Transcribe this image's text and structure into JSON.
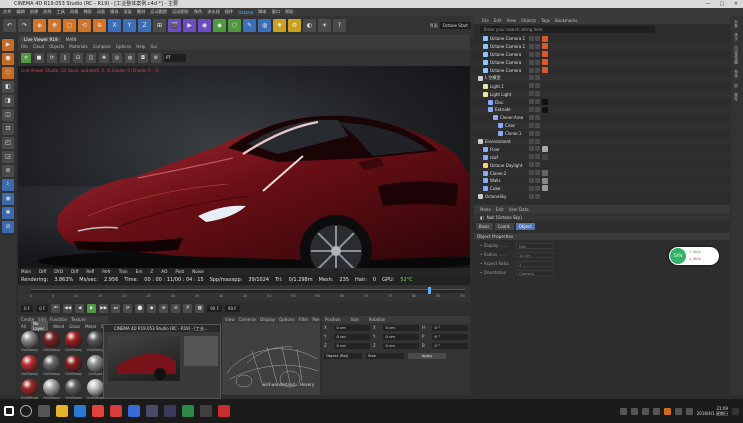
{
  "window": {
    "title": "CINEMA 4D R19.053 Studio (RC - R19) - [工业整体案例.c4d *] - 主要",
    "minimize": "—",
    "maximize": "□",
    "close": "✕"
  },
  "menubar": [
    "文件",
    "编辑",
    "创建",
    "选择",
    "工具",
    "网格",
    "捕捉",
    "动画",
    "模拟",
    "渲染",
    "雕刻",
    "运动跟踪",
    "运动图形",
    "角色",
    "流水线",
    "插件",
    "Octane",
    "脚本",
    "窗口",
    "帮助"
  ],
  "menubar_highlight": "Octane",
  "toolbar": {
    "buttons": [
      "↶",
      "↷",
      "◈",
      "✥",
      "▢",
      "⟲",
      "⊕",
      "X",
      "Y",
      "Z",
      "⊞",
      "🎬",
      "▶",
      "◉",
      "◆",
      "⬡",
      "✎",
      "◍",
      "✸",
      "♻",
      "◐",
      "☀",
      "?"
    ],
    "layout_label": "界面",
    "layout_value": "Octane Start"
  },
  "leftbar": [
    "▶",
    "⬢",
    "⬡",
    "◧",
    "◨",
    "◫",
    "⊡",
    "◰",
    "◲",
    "⊚",
    "⌇",
    "◉",
    "✱",
    "⊘"
  ],
  "viewport": {
    "tabs": [
      "Live Viewer R19",
      "MAIN"
    ],
    "active_tab": "Live Viewer R19",
    "menu": [
      "File",
      "Cloud",
      "Objects",
      "Materials",
      "Compare",
      "Options",
      "Help",
      "Gui"
    ],
    "mode_value": "PT",
    "note": "Live Viewer Studio: [3] Voxel, update(0, 0, 4) Shader 0 (Shader 0 - 1)",
    "status_tabs": [
      "Main",
      "Diff",
      "DYD",
      "Diff",
      "Refl",
      "Refr",
      "Tran",
      "Em",
      "Z",
      "AO",
      "Post",
      "Noise"
    ],
    "render_label": "Rendering:",
    "render_pct": "3.863%",
    "ms_label": "Ms/sec:",
    "ms_val": "2.956",
    "time_label": "Time:",
    "time_val": "00 : 00 : 11/00 : 04 : 15",
    "spp_label": "Spp/maxspp:",
    "spp_val": "39/1024",
    "tri_label": "Tri:",
    "tri_val": "0/1.298m",
    "mesh_label": "Mesh:",
    "mesh_val": "235",
    "hair_label": "Hair:",
    "hair_val": "0",
    "gpu_label": "GPU:",
    "gpu_val": "52°C"
  },
  "timeline": {
    "ticks": [
      "0",
      "5",
      "10",
      "15",
      "20",
      "25",
      "30",
      "35",
      "40",
      "45",
      "50",
      "55",
      "60",
      "65",
      "70",
      "75",
      "80",
      "85",
      "90"
    ],
    "frame_start": "0 F",
    "frame_cur": "0 F",
    "frame_end": "90 F",
    "frame_max": "90 F",
    "buttons": [
      "⏮",
      "◀◀",
      "◀",
      "▶",
      "▶▶",
      "⏭",
      "⟳",
      "⬤",
      "◆",
      "⊕",
      "⊘",
      "P",
      "▦"
    ]
  },
  "materials": {
    "menu": [
      "Create",
      "Edit",
      "Function",
      "Texture"
    ],
    "tabs": [
      "All",
      "No Layer",
      "Wood",
      "Glass",
      "Metal",
      "Car"
    ],
    "active_tab": "No Layer",
    "items": [
      {
        "name": "OctGlossy",
        "color": "#8a8a8a"
      },
      {
        "name": "OctGlossy",
        "color": "#7a2222"
      },
      {
        "name": "OctGlossy",
        "color": "#a32020"
      },
      {
        "name": "OctGlossy",
        "color": "#5a5a5a"
      },
      {
        "name": "OctGlossy",
        "color": "#b83030"
      },
      {
        "name": "OctGlossy",
        "color": "#6a6a6a"
      },
      {
        "name": "OctGlossy",
        "color": "#8a1f1f"
      },
      {
        "name": "OctSpec",
        "color": "#909090"
      },
      {
        "name": "OctDiffuse",
        "color": "#9c2828"
      },
      {
        "name": "OctGlossy",
        "color": "#aaaaaa"
      },
      {
        "name": "OctGlossy",
        "color": "#5f5f5f"
      },
      {
        "name": "OctDiffuse",
        "color": "#c4c4c4"
      }
    ]
  },
  "popup": {
    "title": "CINEMA 4D R19.053 Studio (RC - R19) - [工业..."
  },
  "wireframe": {
    "menu": [
      "View",
      "Cameras",
      "Display",
      "Options",
      "Filter",
      "Panel"
    ],
    "caption": "wild wonderland...  Hovery"
  },
  "coords": {
    "menu": [
      "Position",
      "Size",
      "Rotation"
    ],
    "rows": [
      {
        "axis": "X",
        "pos": "0 cm",
        "size": "0 cm",
        "rot_label": "H",
        "rot": "0 °"
      },
      {
        "axis": "Y",
        "pos": "0 cm",
        "size": "0 cm",
        "rot_label": "P",
        "rot": "0 °"
      },
      {
        "axis": "Z",
        "pos": "0 cm",
        "size": "0 cm",
        "rot_label": "B",
        "rot": "0 °"
      }
    ],
    "mode": "Object (Rel)",
    "size_mode": "Size",
    "apply": "Apply"
  },
  "objects": {
    "menu": [
      "File",
      "Edit",
      "View",
      "Objects",
      "Tags",
      "Bookmarks"
    ],
    "search_placeholder": "Enter your search string here",
    "rows": [
      {
        "name": "Octane Camera.1",
        "indent": 1,
        "color": "#8cc8ff",
        "tag": "#e0582a"
      },
      {
        "name": "Octane Camera.1",
        "indent": 1,
        "color": "#8cc8ff",
        "tag": "#e0582a"
      },
      {
        "name": "Octane Camera",
        "indent": 1,
        "color": "#8cc8ff",
        "tag": "#e0582a"
      },
      {
        "name": "Octane Camera",
        "indent": 1,
        "color": "#8cc8ff",
        "tag": "#e0582a"
      },
      {
        "name": "Octane Camera",
        "indent": 1,
        "color": "#8cc8ff",
        "tag": "#e0582a"
      },
      {
        "name": "L 空模型",
        "indent": 0,
        "color": "#cccccc",
        "tag": ""
      },
      {
        "name": "Light.1",
        "indent": 1,
        "color": "#e8e8a0",
        "tag": ""
      },
      {
        "name": "Light Light",
        "indent": 1,
        "color": "#e8e8a0",
        "tag": ""
      },
      {
        "name": "Disc",
        "indent": 2,
        "color": "#88aaff",
        "tag": "#111"
      },
      {
        "name": "Extrude",
        "indent": 2,
        "color": "#88aaff",
        "tag": "#111"
      },
      {
        "name": "Cloner.Area",
        "indent": 3,
        "color": "#88aaff",
        "tag": ""
      },
      {
        "name": "Ciroc",
        "indent": 4,
        "color": "#88aaff",
        "tag": ""
      },
      {
        "name": "Cloner.1",
        "indent": 4,
        "color": "#88aaff",
        "tag": ""
      },
      {
        "name": "Environment",
        "indent": 0,
        "color": "#cccccc",
        "tag": ""
      },
      {
        "name": "Floor",
        "indent": 1,
        "color": "#88aaff",
        "tag": "#aaa"
      },
      {
        "name": "roof",
        "indent": 1,
        "color": "#88aaff",
        "tag": "#444"
      },
      {
        "name": "Octane Daylight",
        "indent": 1,
        "color": "#ffcc66",
        "tag": ""
      },
      {
        "name": "Cloner.2",
        "indent": 1,
        "color": "#88aaff",
        "tag": "#666"
      },
      {
        "name": "Walls",
        "indent": 1,
        "color": "#88aaff",
        "tag": "#888"
      },
      {
        "name": "Cube",
        "indent": 1,
        "color": "#88aaff",
        "tag": "#999"
      },
      {
        "name": "OctaneSky",
        "indent": 0,
        "color": "#cccccc",
        "tag": ""
      }
    ]
  },
  "attributes": {
    "top": [
      "Mode",
      "Edit",
      "User Data"
    ],
    "path_icon": "◧",
    "path_label": "Null [Octane Sky]",
    "tabs": [
      "Basic",
      "Coord.",
      "Object"
    ],
    "active_tab": "Object",
    "props_title": "Object Properties",
    "rows": [
      {
        "label": "• Display ......",
        "value": "Dot"
      },
      {
        "label": "• Radius ......",
        "value": "10 cm"
      },
      {
        "label": "• Aspect Ratio",
        "value": "1"
      },
      {
        "label": "• Orientation",
        "value": "Camera"
      }
    ]
  },
  "net": {
    "pct": "54%",
    "up": "↑ 0K/s",
    "down": "↓ 0K/s"
  },
  "right_strip": [
    "对象",
    "场次",
    "内容浏览器",
    "构造",
    "层",
    "属性"
  ],
  "taskbar": {
    "icons": [
      {
        "name": "start",
        "color": "#ffffff"
      },
      {
        "name": "search",
        "color": "#555555"
      },
      {
        "name": "task-view",
        "color": "#555555"
      },
      {
        "name": "explorer",
        "color": "#e6b22a"
      },
      {
        "name": "ie",
        "color": "#2a7ad6"
      },
      {
        "name": "chrome",
        "color": "#e3423a"
      },
      {
        "name": "app-red",
        "color": "#d93a3a"
      },
      {
        "name": "app-blue",
        "color": "#3a6bd9"
      },
      {
        "name": "c4d",
        "color": "#4a4a6a"
      },
      {
        "name": "c4d-2",
        "color": "#3a3a5a"
      },
      {
        "name": "app-green",
        "color": "#2e8a4a"
      },
      {
        "name": "app-dark",
        "color": "#404040"
      },
      {
        "name": "screen-recorder",
        "color": "#c82d2d"
      }
    ],
    "clock_time": "21:09",
    "clock_date": "2018/4/1 星期日"
  }
}
